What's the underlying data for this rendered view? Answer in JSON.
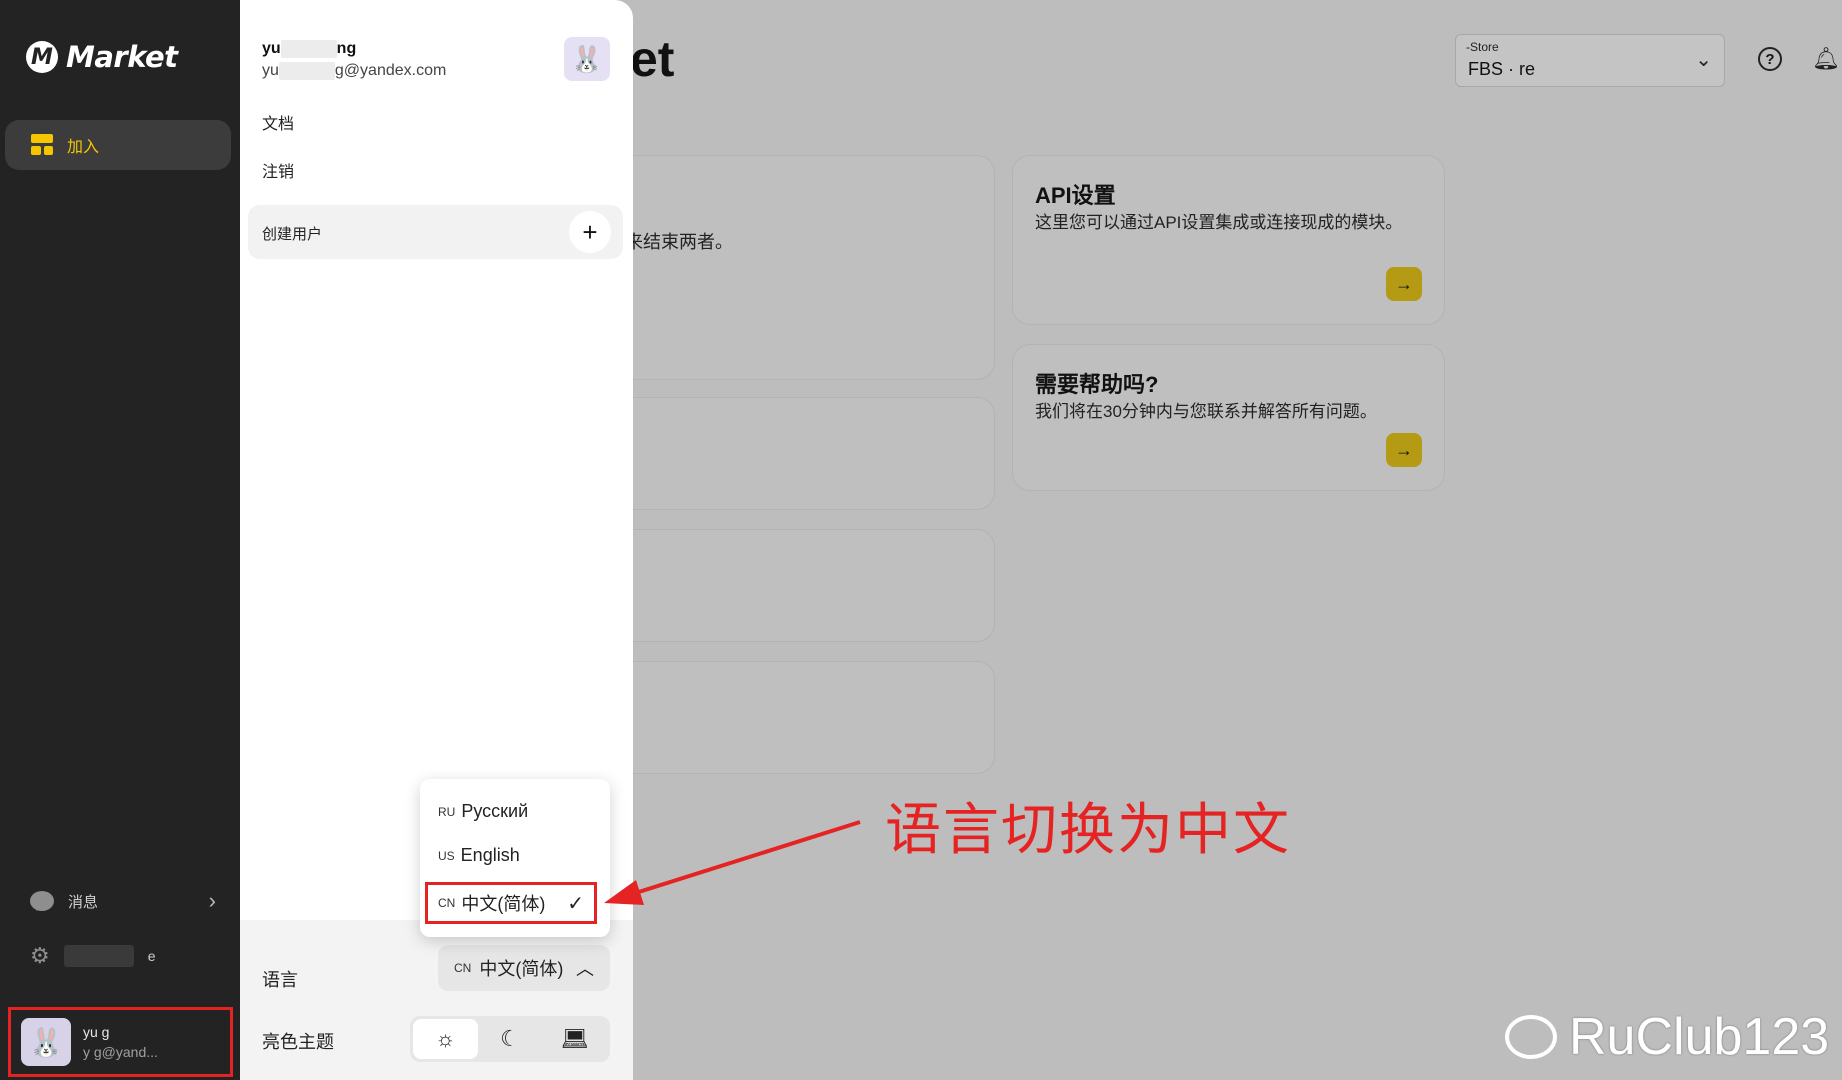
{
  "sidebar": {
    "logo_text": "Market",
    "nav_join_label": "加入",
    "messages_label": "消息",
    "settings_suffix": "e",
    "user": {
      "name": "yu      g",
      "email": "y       g@yand..."
    }
  },
  "main": {
    "title": "et",
    "store": {
      "label": "-Store",
      "value": "FBS ·           re"
    },
    "bg_card_text": "来结束两者。",
    "cards": [
      {
        "title": "API设置",
        "desc": "这里您可以通过API设置集成或连接现成的模块。"
      },
      {
        "title": "需要帮助吗?",
        "desc": "我们将在30分钟内与您联系并解答所有问题。"
      }
    ]
  },
  "panel": {
    "user_name_start": "yu",
    "user_name_end": "ng",
    "user_email_start": "yu",
    "user_email_end": "g@yandex.com",
    "docs_label": "文档",
    "logout_label": "注销",
    "create_user_label": "创建用户",
    "language_label": "语言",
    "language_value_code": "CN",
    "language_value": "中文(简体)",
    "theme_label": "亮色主题"
  },
  "language_dropdown": {
    "options": [
      {
        "code": "RU",
        "label": "Русский"
      },
      {
        "code": "US",
        "label": "English"
      },
      {
        "code": "CN",
        "label": "中文(简体)"
      }
    ]
  },
  "annotation": {
    "text": "语言切换为中文",
    "color": "#e52323"
  },
  "watermark": {
    "text": "RuClub123"
  },
  "colors": {
    "accent": "#f6c700",
    "sidebar_bg": "#232323",
    "annotation_red": "#e52323"
  }
}
